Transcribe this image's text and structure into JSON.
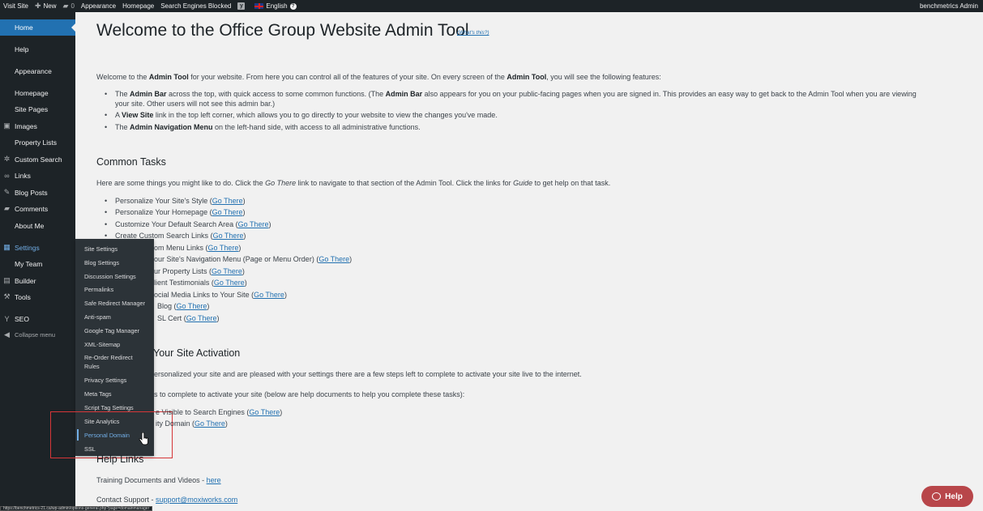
{
  "admin_bar": {
    "visit_site": "Visit Site",
    "new": "New",
    "comments_count": "0",
    "appearance": "Appearance",
    "homepage": "Homepage",
    "search_engines": "Search Engines Blocked",
    "language": "English",
    "user": "benchmetrics Admin",
    "icons": {
      "wp": "wordpress-icon",
      "plus": "plus-icon",
      "comment": "comment-icon",
      "yoast": "yoast-icon",
      "flag": "uk-flag-icon",
      "help": "question-icon"
    }
  },
  "sidebar": {
    "home": "Home",
    "help": "Help",
    "appearance": "Appearance",
    "homepage": "Homepage",
    "site_pages": "Site Pages",
    "images": "Images",
    "property_lists": "Property Lists",
    "custom_search": "Custom Search",
    "links": "Links",
    "blog_posts": "Blog Posts",
    "comments": "Comments",
    "about_me": "About Me",
    "settings": "Settings",
    "my_team": "My Team",
    "builder": "Builder",
    "tools": "Tools",
    "seo": "SEO",
    "collapse": "Collapse menu"
  },
  "flyout": [
    "Site Settings",
    "Blog Settings",
    "Discussion Settings",
    "Permalinks",
    "Safe Redirect Manager",
    "Anti-spam",
    "Google Tag Manager",
    "XML-Sitemap",
    "Re-Order Redirect Rules",
    "Privacy Settings",
    "Meta Tags",
    "Script Tag Settings",
    "Site Analytics",
    "Personal Domain",
    "SSL"
  ],
  "main": {
    "title": "Welcome to the Office Group Website Admin Tool",
    "whats_this": "(What's this?)",
    "intro": {
      "a": "Welcome to the ",
      "b": "Admin Tool",
      "c": " for your website. From here you can control all of the features of your site. On every screen of the ",
      "d": "Admin Tool",
      "e": ", you will see the following features:"
    },
    "features": {
      "f1a": "The ",
      "f1b": "Admin Bar",
      "f1c": " across the top, with quick access to some common functions. (The ",
      "f1d": "Admin Bar",
      "f1e": " also appears for you on your public-facing pages when you are signed in. This provides an easy way to get back to the Admin Tool when you are viewing",
      "f1f": "your site. Other users will not see this admin bar.)",
      "f2a": "A ",
      "f2b": "View Site",
      "f2c": " link in the top left corner, which allows you to go directly to your website to view the changes you've made.",
      "f3a": "The ",
      "f3b": "Admin Navigation Menu",
      "f3c": " on the left-hand side, with access to all administrative functions."
    },
    "common_tasks": {
      "heading": "Common Tasks",
      "intro_a": "Here are some things you might like to do. Click the ",
      "intro_b": "Go There",
      "intro_c": " link to navigate to that section of the Admin Tool. Click the links for ",
      "intro_d": "Guide",
      "intro_e": " to get help on that task.",
      "go_there": "Go There",
      "tasks": [
        "Personalize Your Site's Style",
        "Personalize Your Homepage",
        "Customize Your Default Search Area",
        "Create Custom Search Links",
        "om Menu Links",
        "our Site's Navigation Menu (Page or Menu Order)",
        "ur Property Lists",
        "lient Testimonials",
        "ocial Media Links to Your Site",
        "Blog",
        "SL Cert"
      ]
    },
    "activation": {
      "heading": "Your Site Activation",
      "p1": "ersonalized your site and are pleased with your settings there are a few steps left to complete to activate your site live to the internet.",
      "p2": "s to complete to activate your site (below are help documents to help you complete these tasks):",
      "items": [
        "e Visible to Search Engines",
        "ity Domain"
      ]
    },
    "help_links": {
      "heading": "Help Links",
      "training": "Training Documents and Videos - ",
      "here": "here",
      "contact": "Contact Support - ",
      "email": "support@moxiworks.com"
    }
  },
  "help_button": "Help",
  "status_url": "https://benchmetrics-21.ca/wp-admin/options-general.php?page=domainmanager"
}
